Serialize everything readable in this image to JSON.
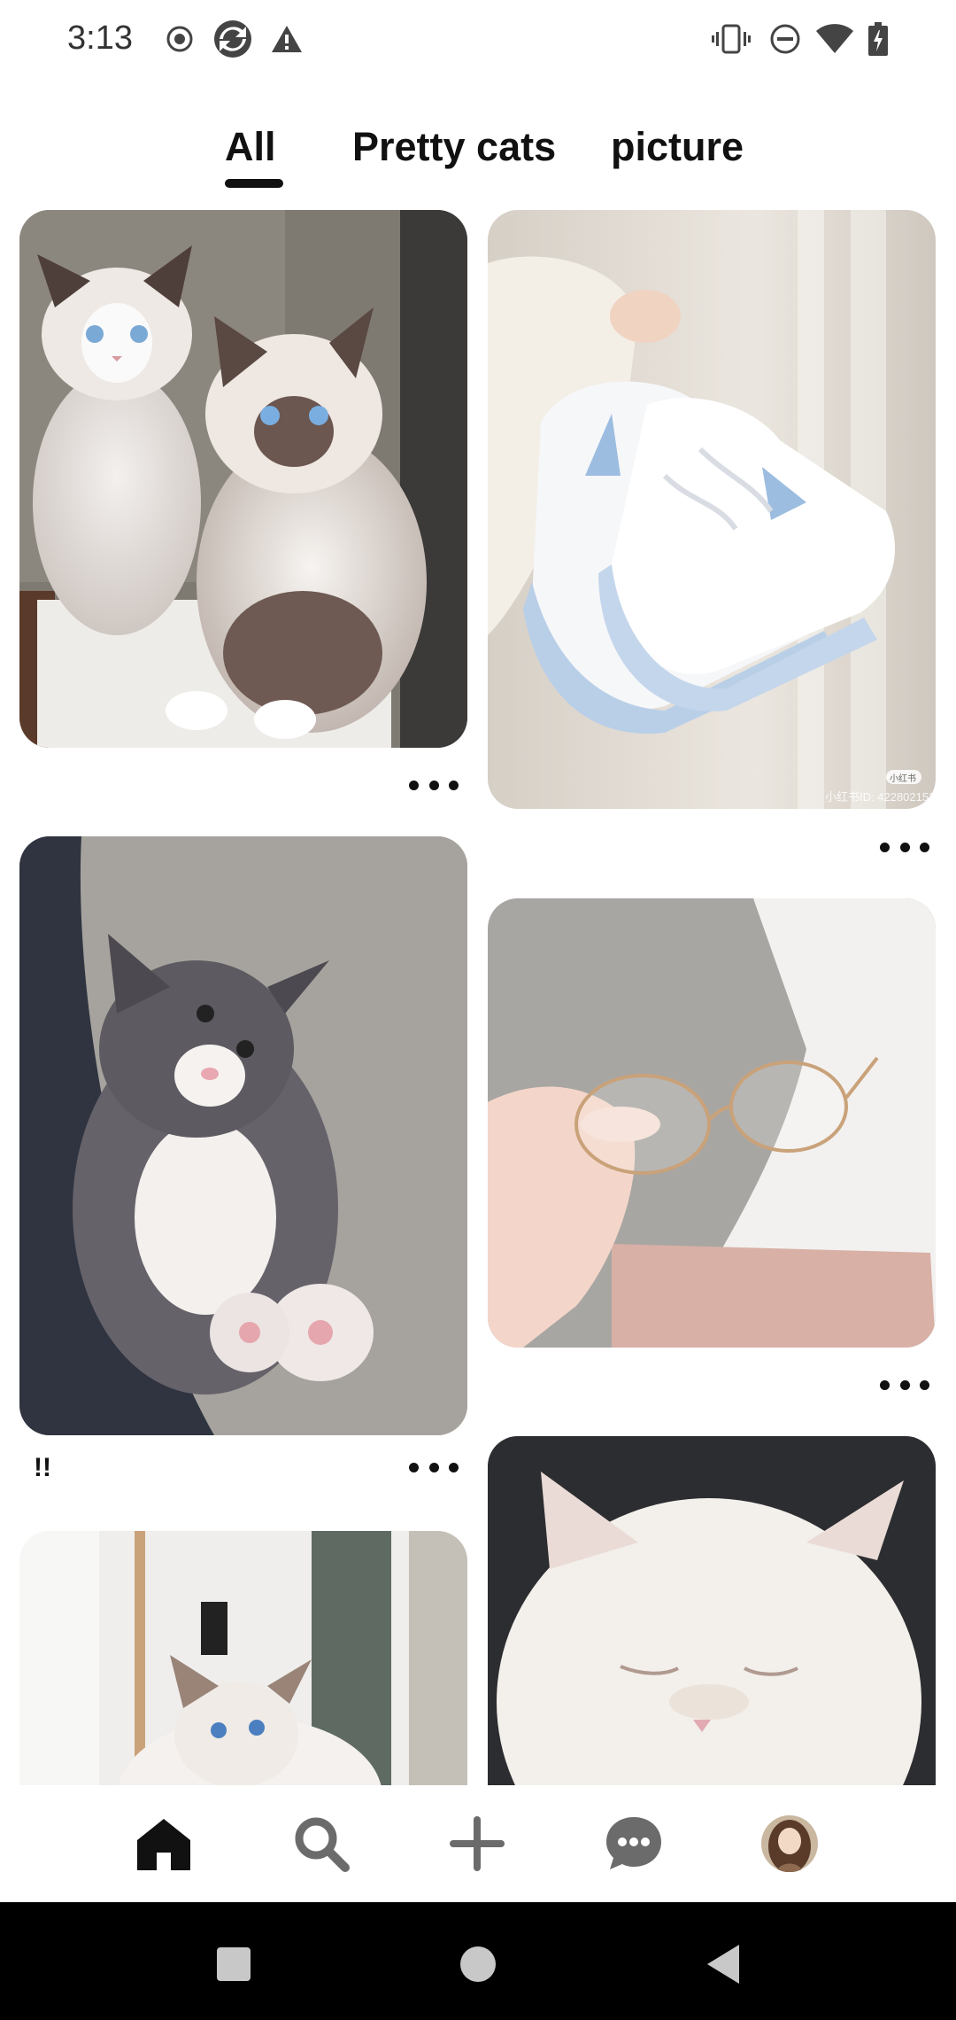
{
  "status_bar": {
    "time": "3:13",
    "left_icons": [
      "record-icon",
      "sync-app-icon",
      "warning-icon"
    ],
    "right_icons": [
      "vibrate-icon",
      "do-not-disturb-icon",
      "wifi-icon",
      "battery-charging-icon"
    ]
  },
  "tabs": [
    {
      "label": "All",
      "active": true
    },
    {
      "label": "Pretty cats",
      "active": false
    },
    {
      "label": "picture",
      "active": false
    }
  ],
  "feed": {
    "pins": [
      {
        "id": "ragdoll-kittens",
        "caption": ""
      },
      {
        "id": "sneakers",
        "caption": "",
        "watermark_badge": "小红书",
        "watermark_text": "小红书ID: 422802152"
      },
      {
        "id": "grey-kitten",
        "caption": "!!"
      },
      {
        "id": "glasses",
        "caption": ""
      },
      {
        "id": "ragdoll-cat",
        "caption": ""
      },
      {
        "id": "white-kitten",
        "caption": ""
      }
    ]
  },
  "bottom_nav": {
    "items": [
      "home-icon",
      "search-icon",
      "create-icon",
      "messages-icon",
      "profile-avatar"
    ],
    "active": "home-icon"
  },
  "system_nav": [
    "recents-button",
    "home-button",
    "back-button"
  ]
}
